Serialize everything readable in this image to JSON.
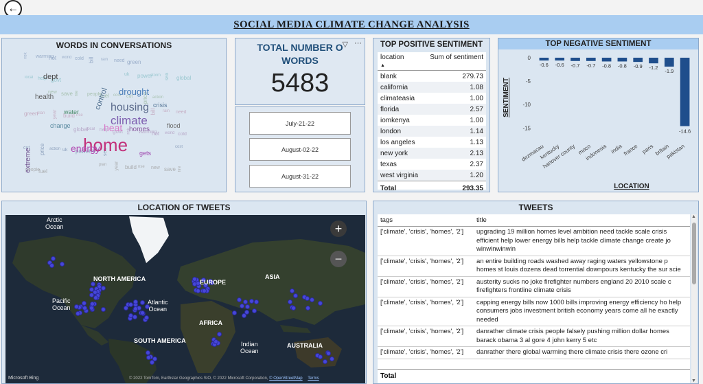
{
  "back_button": {
    "icon": "arrow-left-icon"
  },
  "report_title": "SOCIAL MEDIA CLIMATE CHANGE ANALYSIS",
  "word_cloud": {
    "title": "WORDS IN CONVERSATIONS",
    "words": [
      {
        "text": "home",
        "color": "#c2307a"
      },
      {
        "text": "climate",
        "color": "#7d5fb0"
      },
      {
        "text": "housing",
        "color": "#5b6b8c"
      },
      {
        "text": "heat",
        "color": "#d67ac8"
      },
      {
        "text": "energy",
        "color": "#b04ab2"
      },
      {
        "text": "drought",
        "color": "#4a7db8"
      },
      {
        "text": "dept",
        "color": "#4a4a4a"
      },
      {
        "text": "health",
        "color": "#5a5a5a"
      },
      {
        "text": "extreme",
        "color": "#6a4a8a"
      },
      {
        "text": "control",
        "color": "#4a6a8a"
      },
      {
        "text": "gets",
        "color": "#a04ab0"
      },
      {
        "text": "crisis",
        "color": "#5a7a9a"
      },
      {
        "text": "homes",
        "color": "#8a5aa0"
      },
      {
        "text": "change",
        "color": "#5a8aa0"
      },
      {
        "text": "flood",
        "color": "#6a6a6a"
      },
      {
        "text": "water",
        "color": "#4a8a6a"
      }
    ]
  },
  "total_words": {
    "title_line1": "TOTAL NUMBER O",
    "title_line2": "WORDS",
    "value": "5483",
    "dates": [
      "July-21-22",
      "August-02-22",
      "August-31-22"
    ]
  },
  "positive": {
    "title": "TOP POSITIVE SENTIMENT",
    "col_location": "location",
    "col_sum": "Sum of sentiment",
    "rows": [
      {
        "location": "blank",
        "value": "279.73"
      },
      {
        "location": "california",
        "value": "1.08"
      },
      {
        "location": "climateasia",
        "value": "1.00"
      },
      {
        "location": "florida",
        "value": "2.57"
      },
      {
        "location": "iomkenya",
        "value": "1.00"
      },
      {
        "location": "london",
        "value": "1.14"
      },
      {
        "location": "los angeles",
        "value": "1.13"
      },
      {
        "location": "new york",
        "value": "2.13"
      },
      {
        "location": "texas",
        "value": "2.37"
      },
      {
        "location": "west virginia",
        "value": "1.20"
      }
    ],
    "total_label": "Total",
    "total_value": "293.35"
  },
  "chart_data": {
    "type": "bar",
    "title": "TOP NEGATIVE SENTIMENT",
    "xlabel": "LOCATION",
    "ylabel": "SENTIMENT",
    "categories": [
      "dezmacau",
      "kentucky",
      "hanover county",
      "moco",
      "indonesia",
      "india",
      "france",
      "paris",
      "britain",
      "pakistan"
    ],
    "values": [
      -0.6,
      -0.6,
      -0.7,
      -0.7,
      -0.8,
      -0.8,
      -0.9,
      -1.2,
      -1.9,
      -14.6
    ],
    "data_labels": [
      "-0.6",
      "-0.6",
      "-0.7",
      "-0.7",
      "-0.8",
      "-0.8",
      "-0.9",
      "-1.2",
      "-1.9",
      "-14.6"
    ],
    "yticks": [
      "0",
      "-5",
      "-10",
      "-15"
    ],
    "ylim": [
      -17,
      0
    ],
    "bar_color": "#1f4e8c"
  },
  "map": {
    "title": "LOCATION OF TWEETS",
    "labels": [
      {
        "text": "Arctic\nOcean",
        "bold": false
      },
      {
        "text": "NORTH AMERICA",
        "bold": true
      },
      {
        "text": "EUROPE",
        "bold": true
      },
      {
        "text": "ASIA",
        "bold": true
      },
      {
        "text": "Pacific\nOcean",
        "bold": false
      },
      {
        "text": "Atlantic\nOcean",
        "bold": false
      },
      {
        "text": "AFRICA",
        "bold": true
      },
      {
        "text": "SOUTH AMERICA",
        "bold": true
      },
      {
        "text": "Indian\nOcean",
        "bold": false
      },
      {
        "text": "AUSTRALIA",
        "bold": true
      }
    ],
    "zoom_in": "+",
    "zoom_out": "−",
    "attribution_logo": "Microsoft Bing",
    "attribution_text": "© 2022 TomTom, Earthstar Geographics SIO, © 2022 Microsoft Corporation,",
    "osm_link": "© OpenStreetMap",
    "terms": "Terms"
  },
  "tweets": {
    "title": "TWEETS",
    "col_tags": "tags",
    "col_title": "title",
    "rows": [
      {
        "tags": "['climate', 'crisis', 'homes', '2']",
        "title": "upgrading 19 million homes level ambition need tackle scale crisis efficient help lower energy bills help tackle climate change create jo winwinwinwin"
      },
      {
        "tags": "['climate', 'crisis', 'homes', '2']",
        "title": "an entire building roads washed away raging waters yellowstone p homes st louis dozens dead torrential downpours kentucky the sur scie"
      },
      {
        "tags": "['climate', 'crisis', 'homes', '2']",
        "title": "austerity sucks no joke firefighter numbers england 20 2010 scale c firefighters frontline climate crisis"
      },
      {
        "tags": "['climate', 'crisis', 'homes', '2']",
        "title": "capping energy bills now 1000 bills improving energy efficiency ho help consumers jobs investment british economy years come all he exactly needed"
      },
      {
        "tags": "['climate', 'crisis', 'homes', '2']",
        "title": "danrather climate crisis people falsely pushing million dollar homes barack obama 3 al gore 4 john kerry 5 etc"
      },
      {
        "tags": "['climate', 'crisis', 'homes', '2']",
        "title": "danrather there global warming there climate crisis there ozone cri"
      }
    ],
    "total_label": "Total"
  }
}
